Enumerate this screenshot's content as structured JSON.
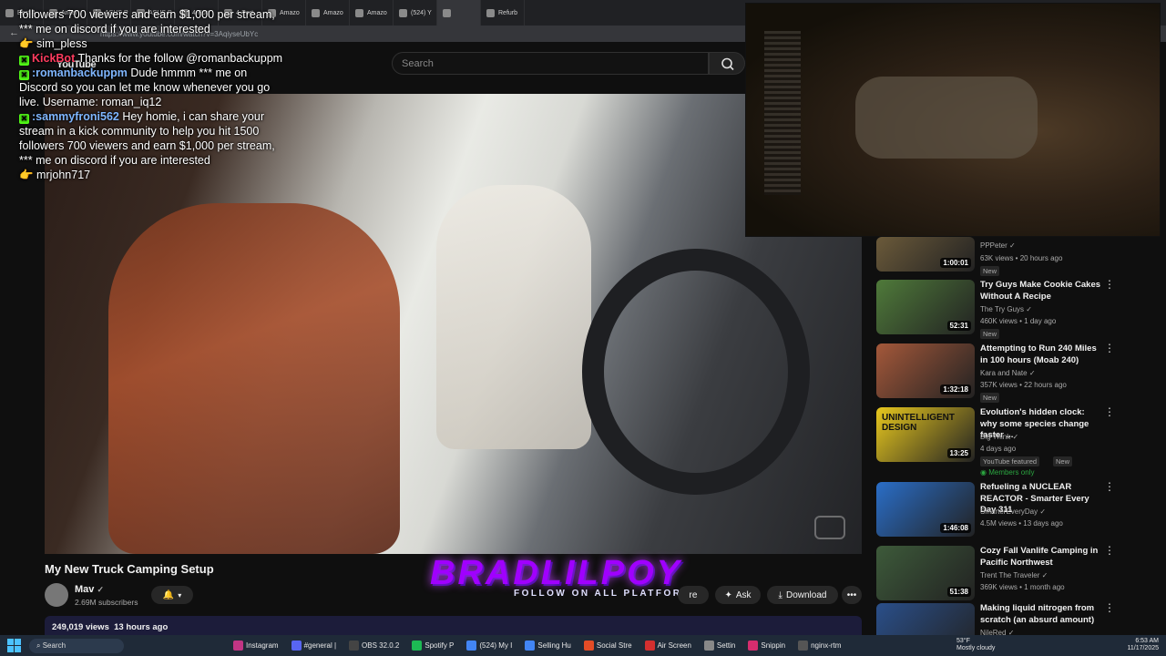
{
  "browser": {
    "tabs": [
      "Best A",
      "Anker",
      "ASUS P",
      "ASUS P",
      "4-Port",
      "4-Port",
      "Amazo",
      "Amazo",
      "Amazo",
      "(524) Y",
      "",
      "Refurb"
    ],
    "address": "https://www.youtube.com/watch?v=3AqiyseUbYc"
  },
  "youtube": {
    "logo": "YouTube",
    "search_placeholder": "Search"
  },
  "chat": [
    {
      "user": "",
      "text": "followers 700 viewers and earn $1,000 per stream, *** me on discord if you are interested"
    },
    {
      "user": "",
      "text": "👉 sim_pless"
    },
    {
      "user": "KickBot",
      "text": " Thanks for the follow @romanbackuppm",
      "bot": true
    },
    {
      "user": ":romanbackuppm",
      "text": " Dude hmmm *** me on Discord so you can let me know whenever you go live. Username: roman_iq12"
    },
    {
      "user": ":sammyfroni562",
      "text": " Hey homie, i can share your stream in a kick community to help you hit 1500 followers 700 viewers and earn $1,000 per stream, *** me on discord if you are interested"
    },
    {
      "user": "",
      "text": "👉 mrjohn717"
    }
  ],
  "branding": {
    "name": "BRADLILPOY",
    "tagline": "FOLLOW ON ALL PLATFORMS"
  },
  "video": {
    "title": "My New Truck Camping Setup",
    "channel": "Mav",
    "subscribers": "2.69M subscribers",
    "views": "249,019 views",
    "posted": "13 hours ago",
    "ask_label": "Ask",
    "download_label": "Download",
    "share_label": "re"
  },
  "recommendations": [
    {
      "title": "",
      "channel": "PPPeter",
      "meta": "63K views • 20 hours ago",
      "duration": "1:00:01",
      "tag": "New",
      "thumb": "#6b5a3a"
    },
    {
      "title": "Try Guys Make Cookie Cakes Without A Recipe",
      "channel": "The Try Guys",
      "meta": "460K views • 1 day ago",
      "duration": "52:31",
      "tag": "New",
      "thumb": "#4f7a3a"
    },
    {
      "title": "Attempting to Run 240 Miles in 100 hours (Moab 240)",
      "channel": "Kara and Nate",
      "meta": "357K views • 22 hours ago",
      "duration": "1:32:18",
      "tag": "New",
      "thumb": "#a4583a"
    },
    {
      "title": "Evolution's hidden clock: why some species change faster ...",
      "channel": "Big Think",
      "meta": "4 days ago",
      "duration": "13:25",
      "tag": "YouTube featured",
      "tag2": "New",
      "extra": "Members only",
      "thumb": "#e8c81e",
      "thumb_text": "UNINTELLIGENT DESIGN"
    },
    {
      "title": "Refueling a NUCLEAR REACTOR - Smarter Every Day 311",
      "channel": "SmarterEveryDay",
      "meta": "4.5M views • 13 days ago",
      "duration": "1:46:08",
      "tag": "",
      "thumb": "#2a6ec8"
    },
    {
      "title": "Cozy Fall Vanlife Camping in Pacific Northwest",
      "channel": "Trent The Traveler",
      "meta": "369K views • 1 month ago",
      "duration": "51:38",
      "tag": "",
      "thumb": "#3d5a3a"
    },
    {
      "title": "Making liquid nitrogen from scratch (an absurd amount)",
      "channel": "NileRed",
      "meta": "",
      "duration": "",
      "tag": "",
      "thumb": "#2a4f8a"
    }
  ],
  "taskbar": {
    "search": "Search",
    "apps": [
      "Instagram",
      "#general |",
      "OBS 32.0.2",
      "Spotify P",
      "(524) My I",
      "Selling Hu",
      "Social Stre",
      "Air Screen",
      "Settin",
      "Snippin",
      "nginx-rtm"
    ],
    "weather_temp": "53°F",
    "weather_desc": "Mostly cloudy",
    "time": "6:53 AM",
    "date": "11/17/2025"
  }
}
